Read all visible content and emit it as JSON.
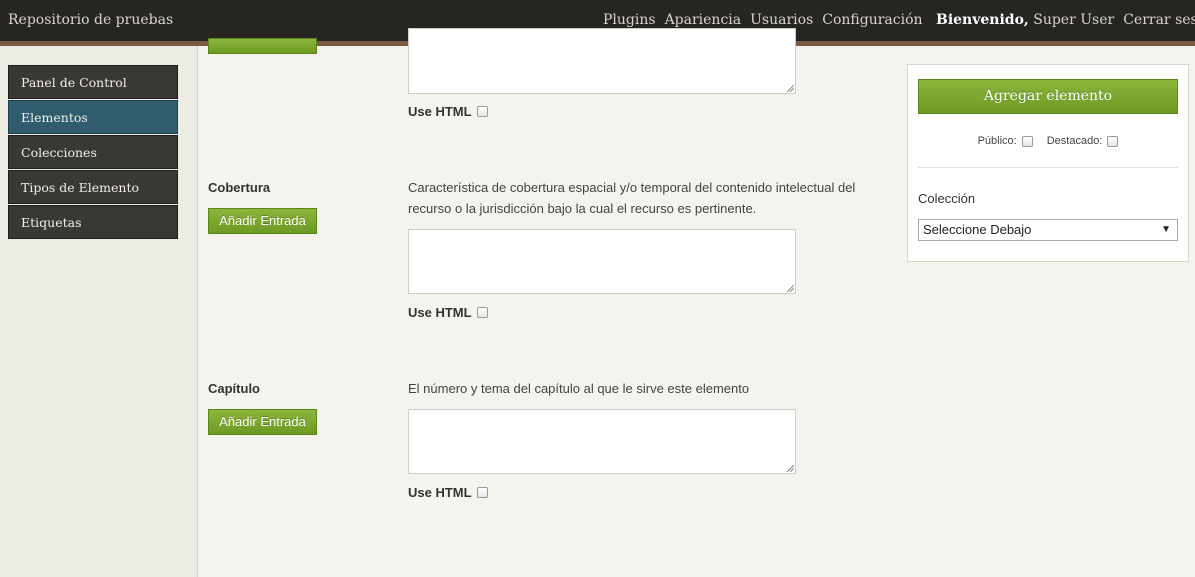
{
  "header": {
    "site_title": "Repositorio de pruebas",
    "nav": [
      "Plugins",
      "Apariencia",
      "Usuarios",
      "Configuración"
    ],
    "welcome": "Bienvenido,",
    "user": "Super User",
    "logout": "Cerrar sesión"
  },
  "sidebar": {
    "items": [
      {
        "label": "Panel de Control",
        "active": false
      },
      {
        "label": "Elementos",
        "active": true
      },
      {
        "label": "Colecciones",
        "active": false
      },
      {
        "label": "Tipos de Elemento",
        "active": false
      },
      {
        "label": "Etiquetas",
        "active": false
      }
    ]
  },
  "fields": {
    "previous": {
      "use_html_label": "Use HTML"
    },
    "cobertura": {
      "label": "Cobertura",
      "add_button": "Añadir Entrada",
      "description": "Característica de cobertura espacial y/o temporal del contenido intelectual del recurso o la jurisdicción bajo la cual el recurso es pertinente.",
      "use_html_label": "Use HTML"
    },
    "capitulo": {
      "label": "Capítulo",
      "add_button": "Añadir Entrada",
      "description": "El número y tema del capítulo al que le sirve este elemento",
      "use_html_label": "Use HTML"
    }
  },
  "panel": {
    "add_item_button": "Agregar elemento",
    "public_label": "Público:",
    "featured_label": "Destacado:",
    "collection_title": "Colección",
    "collection_select_value": "Seleccione Debajo"
  },
  "colors": {
    "header_bg": "#262522",
    "header_border": "#7a5a43",
    "sidebar_item_bg": "#3a3835",
    "sidebar_active_bg": "#2f5c6f",
    "button_green": "#7aa72f"
  }
}
